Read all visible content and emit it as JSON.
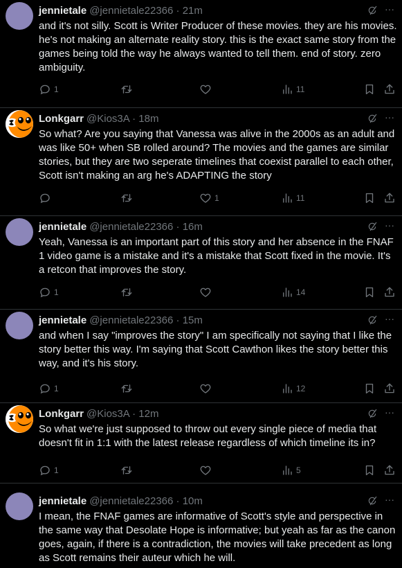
{
  "colors": {
    "background": "#000000",
    "text": "#e7e9ea",
    "muted": "#71767b",
    "divider": "#2f3336",
    "jennietale_avatar": "#8c86b9",
    "lonkgarr_avatar": "#ff8a00"
  },
  "icons": {
    "reply": "reply-icon",
    "retweet": "retweet-icon",
    "like": "heart-icon",
    "views": "views-bar-chart-icon",
    "bookmark": "bookmark-icon",
    "share": "share-icon",
    "grok": "grok-icon",
    "more": "more-dots-icon"
  },
  "tweets": [
    {
      "name": "jennietale",
      "handle": "@jennietale22366",
      "time": "· 21m",
      "text": "and it's not silly. Scott is Writer Producer of these movies. they are his movies. he's not making an alternate reality story. this is the exact same story from the games being told the way he always wanted to tell them. end of story. zero ambiguity.",
      "replies": "1",
      "retweets": "",
      "likes": "",
      "views": "11"
    },
    {
      "name": "Lonkgarr",
      "handle": "@Kios3A",
      "time": "· 18m",
      "text": "So what? Are you saying that Vanessa was alive in the 2000s as an adult and was like 50+ when SB rolled around? The movies and the games are similar stories, but they are two seperate timelines that coexist parallel to each other, Scott isn't making an arg he's ADAPTING the story",
      "replies": "",
      "retweets": "",
      "likes": "1",
      "views": "11"
    },
    {
      "name": "jennietale",
      "handle": "@jennietale22366",
      "time": "· 16m",
      "text": "Yeah, Vanessa is an important part of this story and her absence in the FNAF 1 video game is a mistake and it's a mistake that Scott fixed in the movie. It's a retcon that improves the story.",
      "replies": "1",
      "retweets": "",
      "likes": "",
      "views": "14"
    },
    {
      "name": "jennietale",
      "handle": "@jennietale22366",
      "time": "· 15m",
      "text": "and when I say \"improves the story\" I am specifically not saying that I like the story better this way. I'm saying that Scott Cawthon likes the story better this way, and it's his story.",
      "replies": "1",
      "retweets": "",
      "likes": "",
      "views": "12"
    },
    {
      "name": "Lonkgarr",
      "handle": "@Kios3A",
      "time": "· 12m",
      "text": "So what we're just supposed to throw out every single piece of media that doesn't fit in 1:1 with the latest release regardless of which timeline its in?",
      "replies": "1",
      "retweets": "",
      "likes": "",
      "views": "5"
    },
    {
      "name": "jennietale",
      "handle": "@jennietale22366",
      "time": "· 10m",
      "text": "I mean, the FNAF games are informative of Scott's style and perspective in the same way that Desolate Hope is informative; but yeah as far as the canon goes, again, if there is a contradiction, the movies will take precedent as long as Scott remains their auteur which he will.",
      "replies": "",
      "retweets": "",
      "likes": "",
      "views": ""
    }
  ]
}
